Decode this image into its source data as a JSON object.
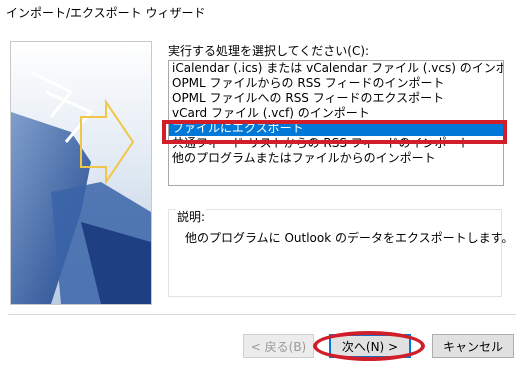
{
  "window": {
    "title": "インポート/エクスポート ウィザード"
  },
  "prompt": "実行する処理を選択してください(C):",
  "actions": [
    {
      "label": "iCalendar (.ics) または vCalendar ファイル (.vcs) のインポート",
      "selected": false
    },
    {
      "label": "OPML ファイルからの RSS フィードのインポート",
      "selected": false
    },
    {
      "label": "OPML ファイルへの RSS フィードのエクスポート",
      "selected": false
    },
    {
      "label": "vCard ファイル (.vcf) のインポート",
      "selected": false
    },
    {
      "label": "ファイルにエクスポート",
      "selected": true
    },
    {
      "label": "共通フィード リストからの RSS フィードのインポート",
      "selected": false
    },
    {
      "label": "他のプログラムまたはファイルからのインポート",
      "selected": false
    }
  ],
  "description": {
    "label": "説明:",
    "text": "他のプログラムに Outlook のデータをエクスポートします。"
  },
  "buttons": {
    "back": "< 戻る(B)",
    "next": "次へ(N) >",
    "cancel": "キャンセル"
  },
  "colors": {
    "selection": "#0078d7",
    "annotation_red": "#d01f2a"
  }
}
